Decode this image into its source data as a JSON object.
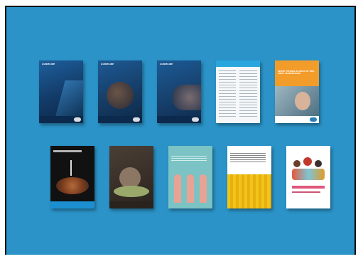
{
  "covers": [
    {
      "top_label": "GUIDELINE",
      "title": "RECORD COVERS OVERVIEW",
      "subtitle": "",
      "theme": "navy"
    },
    {
      "top_label": "GUIDELINE",
      "title": "",
      "subtitle": "",
      "theme": "navy-photo"
    },
    {
      "top_label": "GUIDELINE",
      "title": "",
      "subtitle": "",
      "theme": "navy-photo2"
    },
    {
      "top_label": "",
      "title": "",
      "subtitle": "",
      "theme": "document"
    },
    {
      "top_label": "",
      "title": "INFANT FEEDING IN AREAS OF ZIKA VIRUS TRANSMISSION",
      "subtitle": "",
      "theme": "orange"
    },
    {
      "top_label": "",
      "title": "",
      "subtitle": "",
      "theme": "black"
    },
    {
      "top_label": "",
      "title": "",
      "subtitle": "",
      "theme": "dark-brown"
    },
    {
      "top_label": "",
      "title": "",
      "subtitle": "",
      "theme": "teal-figures"
    },
    {
      "top_label": "",
      "title": "",
      "subtitle": "",
      "theme": "yellow"
    },
    {
      "top_label": "",
      "title": "",
      "subtitle": "",
      "theme": "white-illus"
    }
  ]
}
